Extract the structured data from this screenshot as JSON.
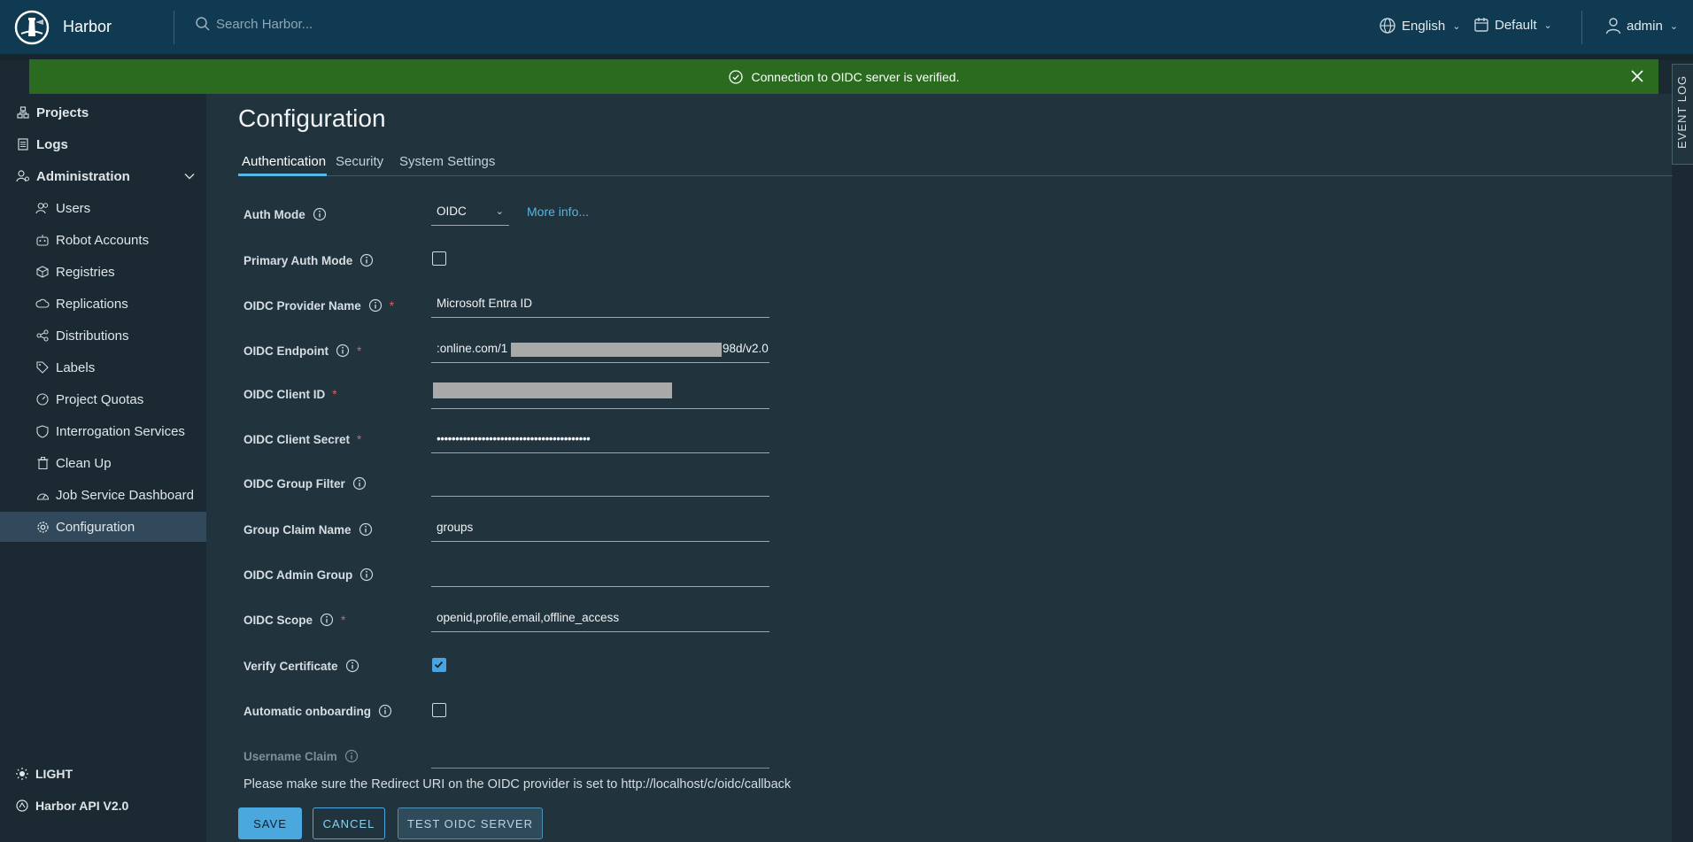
{
  "header": {
    "brand": "Harbor",
    "search_placeholder": "Search Harbor...",
    "language": "English",
    "project": "Default",
    "user": "admin"
  },
  "banner": {
    "message": "Connection to OIDC server is verified.",
    "color": "#2a6b1f"
  },
  "sidebar": {
    "top_items": [
      {
        "label": "Projects",
        "icon": "projects-icon"
      },
      {
        "label": "Logs",
        "icon": "logs-icon"
      },
      {
        "label": "Administration",
        "icon": "administration-icon"
      }
    ],
    "admin_items": [
      {
        "label": "Users",
        "icon": "users-icon"
      },
      {
        "label": "Robot Accounts",
        "icon": "robot-icon"
      },
      {
        "label": "Registries",
        "icon": "registries-icon"
      },
      {
        "label": "Replications",
        "icon": "replications-icon"
      },
      {
        "label": "Distributions",
        "icon": "distributions-icon"
      },
      {
        "label": "Labels",
        "icon": "labels-icon"
      },
      {
        "label": "Project Quotas",
        "icon": "quotas-icon"
      },
      {
        "label": "Interrogation Services",
        "icon": "shield-icon"
      },
      {
        "label": "Clean Up",
        "icon": "trash-icon"
      },
      {
        "label": "Job Service Dashboard",
        "icon": "dashboard-icon"
      },
      {
        "label": "Configuration",
        "icon": "gear-icon"
      }
    ],
    "active": "Configuration",
    "theme": "LIGHT",
    "api": "Harbor API V2.0"
  },
  "main": {
    "title": "Configuration",
    "tabs": [
      "Authentication",
      "Security",
      "System Settings"
    ],
    "active_tab": "Authentication",
    "form": {
      "auth_mode": {
        "label": "Auth Mode",
        "value": "OIDC",
        "link": "More info..."
      },
      "primary_auth_mode": {
        "label": "Primary Auth Mode",
        "checked": false
      },
      "provider_name": {
        "label": "OIDC Provider Name",
        "value": "Microsoft Entra ID"
      },
      "endpoint": {
        "label": "OIDC Endpoint",
        "value_prefix": ":online.com/1",
        "value_suffix": "98d/v2.0"
      },
      "client_id": {
        "label": "OIDC Client ID"
      },
      "client_secret": {
        "label": "OIDC Client Secret",
        "value": "•••••••••••••••••••••••••••••••••••••••••"
      },
      "group_filter": {
        "label": "OIDC Group Filter",
        "value": ""
      },
      "group_claim": {
        "label": "Group Claim Name",
        "value": "groups"
      },
      "admin_group": {
        "label": "OIDC Admin Group",
        "value": ""
      },
      "scope": {
        "label": "OIDC Scope",
        "value": "openid,profile,email,offline_access"
      },
      "verify_cert": {
        "label": "Verify Certificate",
        "checked": true
      },
      "auto_onboarding": {
        "label": "Automatic onboarding",
        "checked": false
      },
      "username_claim": {
        "label": "Username Claim",
        "value": ""
      }
    },
    "note": "Please make sure the Redirect URI on the OIDC provider is set to http://localhost/c/oidc/callback",
    "buttons": {
      "save": "SAVE",
      "cancel": "CANCEL",
      "test": "TEST OIDC SERVER"
    }
  },
  "event_log": "EVENT LOG",
  "required_mark": "*"
}
